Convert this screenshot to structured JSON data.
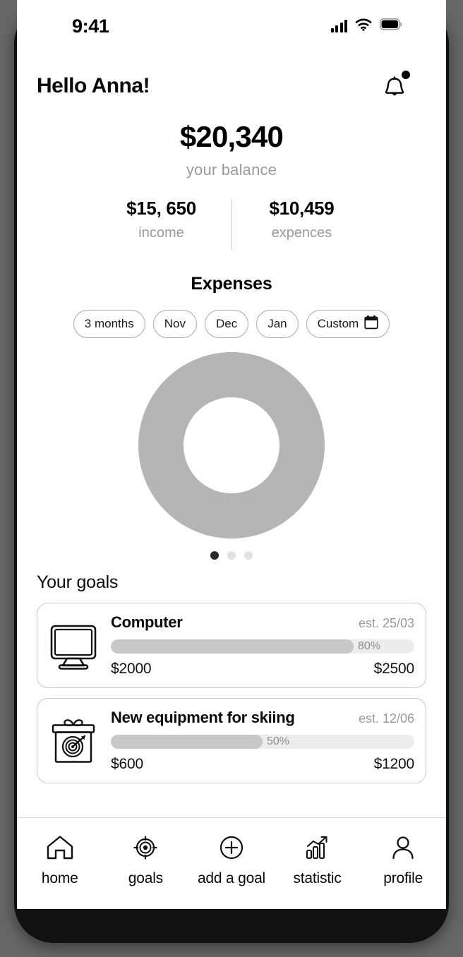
{
  "status_bar": {
    "time": "9:41",
    "signal_icon": "signal-bars-icon",
    "wifi_icon": "wifi-icon",
    "battery_icon": "battery-full-icon"
  },
  "header": {
    "greeting": "Hello Anna!",
    "bell_icon": "notification-bell-icon",
    "has_notification_badge": true
  },
  "balance": {
    "amount": "$20,340",
    "caption": "your balance",
    "income_value": "$15, 650",
    "income_label": "income",
    "expenses_value": "$10,459",
    "expenses_label": "expences"
  },
  "expenses": {
    "title": "Expenses",
    "filters": [
      {
        "label": "3 months",
        "selected": false,
        "icon": null
      },
      {
        "label": "Nov",
        "selected": false,
        "icon": null
      },
      {
        "label": "Dec",
        "selected": false,
        "icon": null
      },
      {
        "label": "Jan",
        "selected": false,
        "icon": null
      },
      {
        "label": "Custom",
        "selected": false,
        "icon": "calendar-icon"
      }
    ],
    "chart": {
      "type": "donut",
      "ring_color": "#b5b5b5",
      "hole_color": "#ffffff"
    },
    "carousel_dots": 3,
    "carousel_active_index": 0
  },
  "goals": {
    "title": "Your goals",
    "items": [
      {
        "icon": "monitor-icon",
        "name": "Computer",
        "estimate": "est. 25/03",
        "progress_label": "80%",
        "progress_percent": 80,
        "current": "$2000",
        "target": "$2500"
      },
      {
        "icon": "gift-target-icon",
        "name": "New equipment for skiing",
        "estimate": "est. 12/06",
        "progress_label": "50%",
        "progress_percent": 50,
        "current": "$600",
        "target": "$1200"
      }
    ]
  },
  "bottom_nav": {
    "items": [
      {
        "label": "home",
        "icon": "home-icon",
        "active": true
      },
      {
        "label": "goals",
        "icon": "target-icon",
        "active": false
      },
      {
        "label": "add a goal",
        "icon": "plus-circle-icon",
        "active": false
      },
      {
        "label": "statistic",
        "icon": "bar-chart-trend-icon",
        "active": false
      },
      {
        "label": "profile",
        "icon": "person-icon",
        "active": false
      }
    ]
  },
  "colors": {
    "background": "#676767",
    "frame": "#111111",
    "screen": "#ffffff",
    "text_primary": "#0a0a0a",
    "text_muted": "#9b9b9b",
    "ring": "#b5b5b5",
    "progress_track": "#ededed",
    "progress_fill": "#c8c8c8"
  }
}
